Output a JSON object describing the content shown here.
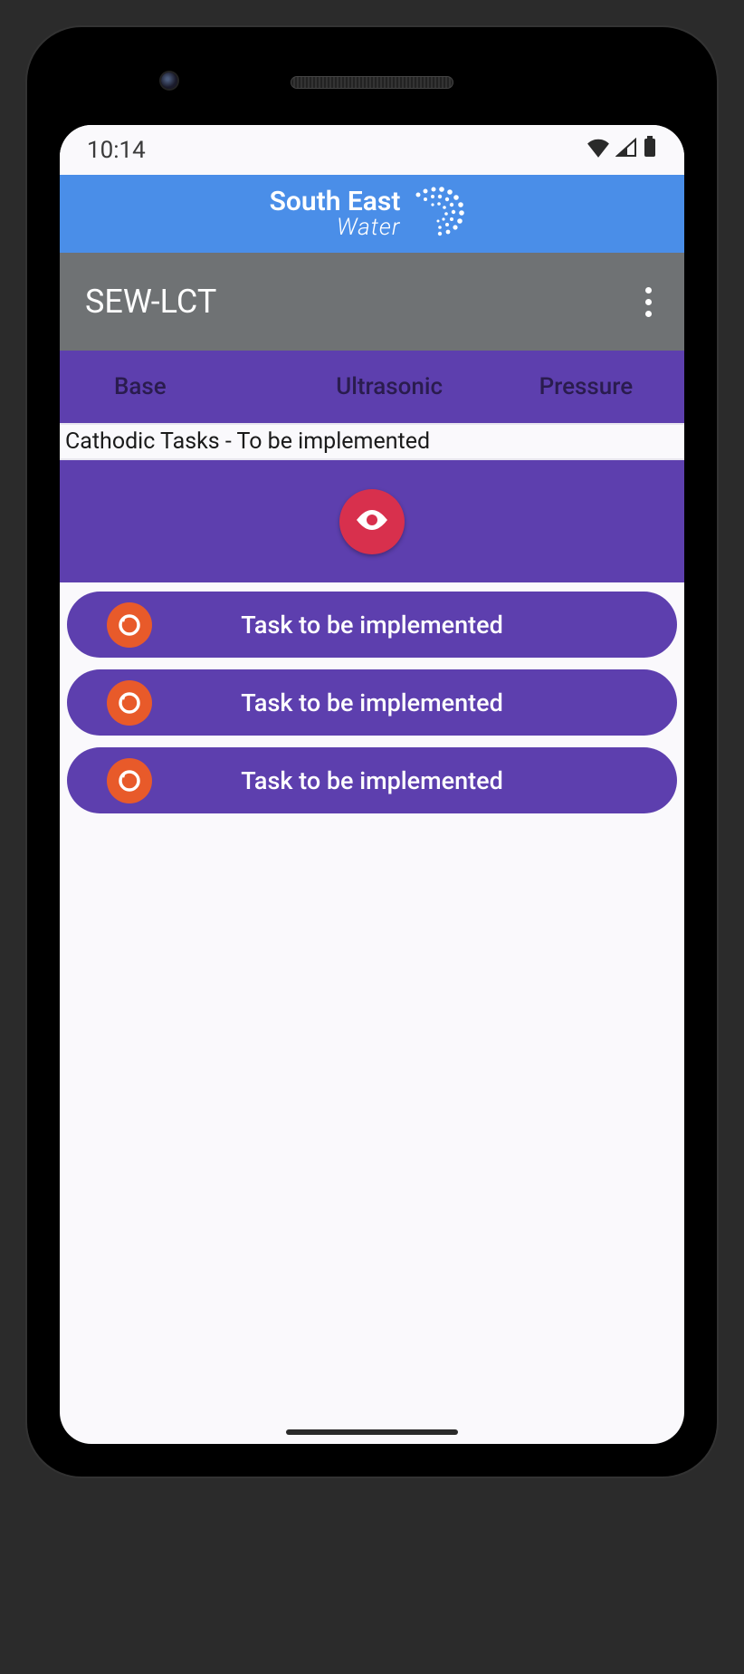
{
  "status": {
    "time": "10:14"
  },
  "brand": {
    "line1": "South East",
    "line2": "Water"
  },
  "appbar": {
    "title": "SEW-LCT"
  },
  "tabs": {
    "items": [
      {
        "label": "Base"
      },
      {
        "label": "Ultrasonic"
      },
      {
        "label": "Pressure"
      }
    ]
  },
  "section": {
    "title": "Cathodic Tasks - To be implemented"
  },
  "tasks": {
    "items": [
      {
        "label": "Task to be implemented"
      },
      {
        "label": "Task to be implemented"
      },
      {
        "label": "Task to be implemented"
      }
    ]
  }
}
